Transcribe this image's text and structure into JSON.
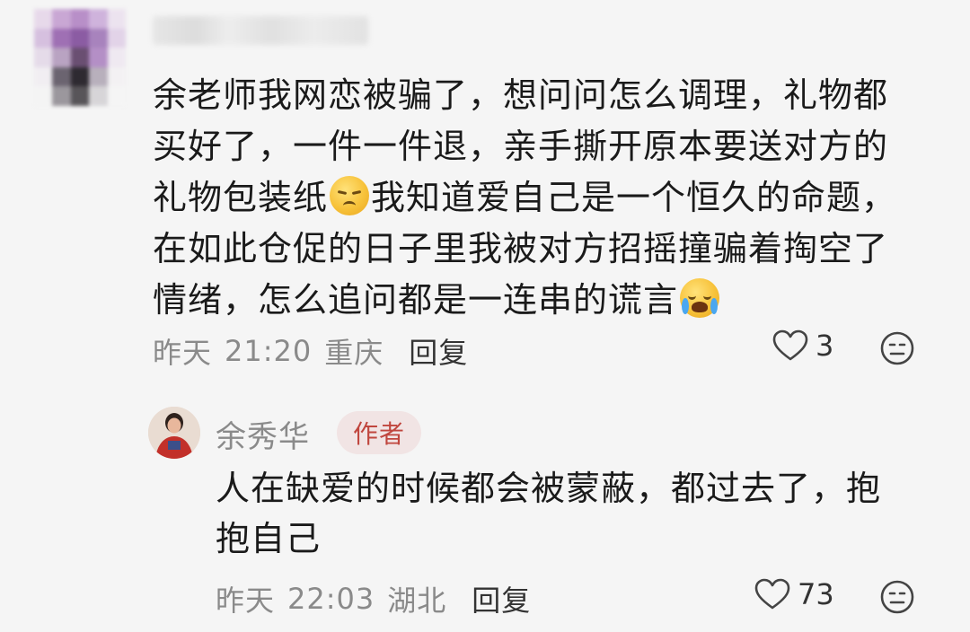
{
  "comment": {
    "text_parts": [
      "余老师我网恋被骗了，想问问怎么调理，礼物都\n买好了，一件一件退，亲手撕开原本要送对方的\n礼物包装纸",
      "我知道爱自己是一个恒久的命题，\n在如此仓促的日子里我被对方招摇撞骗着掏空了\n情绪，怎么追问都是一连串的谎言"
    ],
    "emoji_1": "disappointed-face",
    "emoji_2": "loudly-crying-face",
    "date": "昨天",
    "time": "21:20",
    "location": "重庆",
    "reply_label": "回复",
    "likes": "3"
  },
  "reply": {
    "author": "余秀华",
    "badge": "作者",
    "text": "人在缺爱的时候都会被蒙蔽，都过去了，抱\n抱自己",
    "date": "昨天",
    "time": "22:03",
    "location": "湖北",
    "reply_label": "回复",
    "likes": "73"
  },
  "colors": {
    "background": "#f5f5f5",
    "meta_text": "#8a8a8a",
    "badge_bg": "#f1e4e4",
    "badge_text": "#c0463e"
  }
}
